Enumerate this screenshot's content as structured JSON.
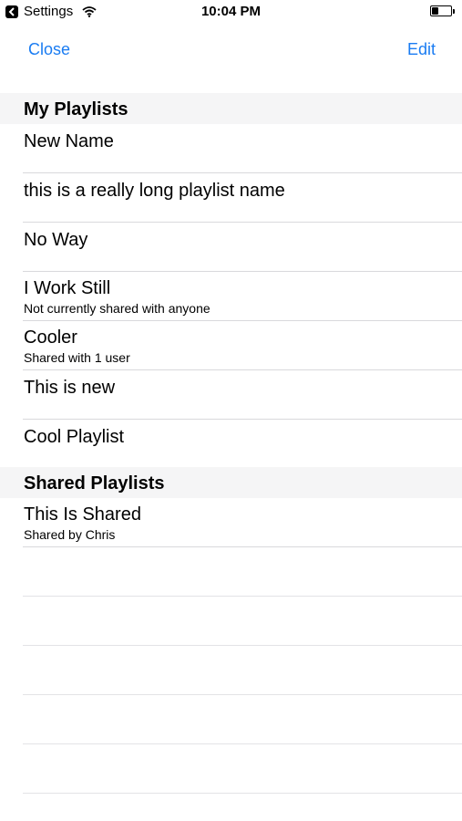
{
  "status_bar": {
    "back_app_label": "Settings",
    "back_icon": "chevron-left-icon",
    "wifi_icon": "wifi-icon",
    "time": "10:04 PM",
    "battery_icon": "battery-icon",
    "battery_level": 0.35
  },
  "nav": {
    "close_label": "Close",
    "edit_label": "Edit",
    "accent_color": "#1a7cf2"
  },
  "my_playlists": {
    "header": "My Playlists",
    "items": [
      {
        "title": "New Name",
        "subtitle": ""
      },
      {
        "title": "this is a really long playlist name",
        "subtitle": ""
      },
      {
        "title": "No Way",
        "subtitle": ""
      },
      {
        "title": "I Work Still",
        "subtitle": "Not currently shared with anyone"
      },
      {
        "title": "Cooler",
        "subtitle": "Shared with 1 user"
      },
      {
        "title": "This is new",
        "subtitle": ""
      },
      {
        "title": "Cool Playlist",
        "subtitle": ""
      }
    ]
  },
  "shared_playlists": {
    "header": "Shared Playlists",
    "items": [
      {
        "title": "This Is Shared",
        "subtitle": "Shared by Chris"
      }
    ]
  }
}
